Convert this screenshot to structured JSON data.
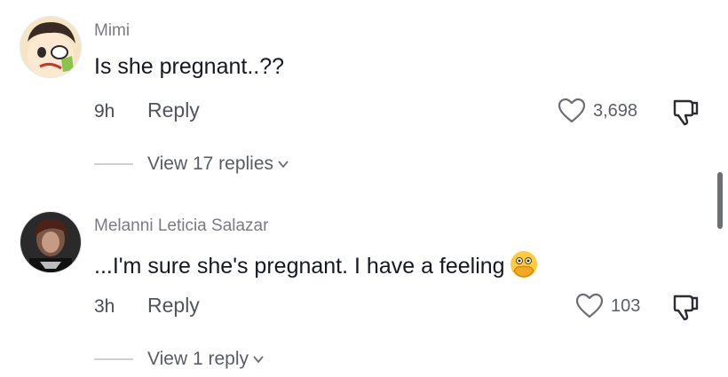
{
  "comments": [
    {
      "username": "Mimi",
      "text": "Is she pregnant..??",
      "time": "9h",
      "reply_label": "Reply",
      "likes": "3,698",
      "view_replies": "View 17 replies"
    },
    {
      "username": "Melanni Leticia Salazar",
      "text": "...I'm sure she's pregnant. I have a feeling",
      "emoji": "face-with-open-eyes-and-hand-over-mouth",
      "time": "3h",
      "reply_label": "Reply",
      "likes": "103",
      "view_replies": "View 1 reply"
    }
  ],
  "colors": {
    "text_primary": "#161823",
    "text_secondary": "#7a7b80",
    "divider": "#cfd0d3",
    "scrollbar": "#6e6f74"
  },
  "icons": [
    "heart-outline-icon",
    "thumbs-down-icon",
    "chevron-down-icon"
  ]
}
